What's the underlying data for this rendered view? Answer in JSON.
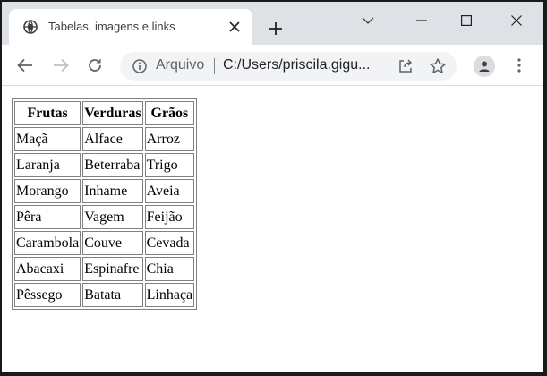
{
  "browser": {
    "tab": {
      "title": "Tabelas, imagens e links"
    },
    "address_bar": {
      "scheme_label": "Arquivo",
      "url": "C:/Users/priscila.gigu..."
    }
  },
  "icons": {
    "tab_favicon": "globe-icon",
    "tab_close": "close-icon",
    "new_tab": "plus-icon",
    "tab_search": "chevron-down-icon",
    "minimize": "minimize-icon",
    "maximize": "maximize-icon",
    "close_window": "close-icon",
    "back": "arrow-left-icon",
    "forward": "arrow-right-icon",
    "reload": "reload-icon",
    "site_info": "info-icon",
    "share": "share-icon",
    "bookmark": "star-icon",
    "profile": "person-icon",
    "menu": "kebab-menu-icon"
  },
  "table": {
    "headers": [
      "Frutas",
      "Verduras",
      "Grãos"
    ],
    "rows": [
      [
        "Maçã",
        "Alface",
        "Arroz"
      ],
      [
        "Laranja",
        "Beterraba",
        "Trigo"
      ],
      [
        "Morango",
        "Inhame",
        "Aveia"
      ],
      [
        "Pêra",
        "Vagem",
        "Feijão"
      ],
      [
        "Carambola",
        "Couve",
        "Cevada"
      ],
      [
        "Abacaxi",
        "Espinafre",
        "Chia"
      ],
      [
        "Pêssego",
        "Batata",
        "Linhaça"
      ]
    ]
  }
}
